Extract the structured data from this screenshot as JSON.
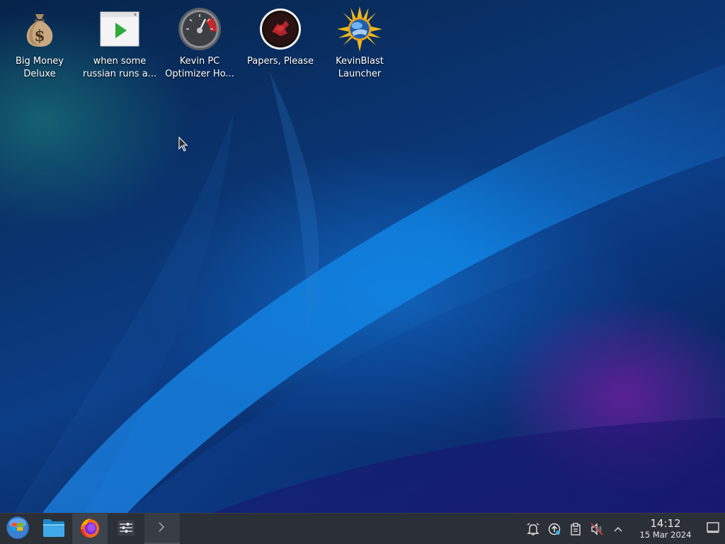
{
  "desktop": {
    "icons": [
      {
        "name": "big-money-deluxe",
        "line1": "Big Money",
        "line2": "Deluxe",
        "icon": "money-bag-icon"
      },
      {
        "name": "when-some-russian",
        "line1": "when some",
        "line2": "russian runs a...",
        "icon": "video-play-icon"
      },
      {
        "name": "kevin-pc-optimizer",
        "line1": "Kevin PC",
        "line2": "Optimizer Ho...",
        "icon": "speedometer-icon"
      },
      {
        "name": "papers-please",
        "line1": "Papers, Please",
        "line2": "",
        "icon": "papers-please-emblem-icon"
      },
      {
        "name": "kevinblast-launcher",
        "line1": "KevinBlast",
        "line2": "Launcher",
        "icon": "sunburst-globe-icon"
      }
    ]
  },
  "taskbar": {
    "launcher_icon": "windows-orb-icon",
    "pinned": [
      "folder-icon",
      "firefox-icon",
      "settings-sliders-icon",
      "terminal-icon"
    ],
    "tray_icons": [
      "notifications-icon",
      "updates-icon",
      "clipboard-icon",
      "volume-muted-icon",
      "chevron-up-icon"
    ],
    "clock": {
      "time": "14:12",
      "date": "15 Mar 2024"
    },
    "show_desktop_icon": "show-desktop-icon"
  },
  "colors": {
    "taskbar_bg": "#2b2f36",
    "wallpaper_blue": "#0b3d86",
    "wallpaper_purple": "#8a18a8"
  }
}
